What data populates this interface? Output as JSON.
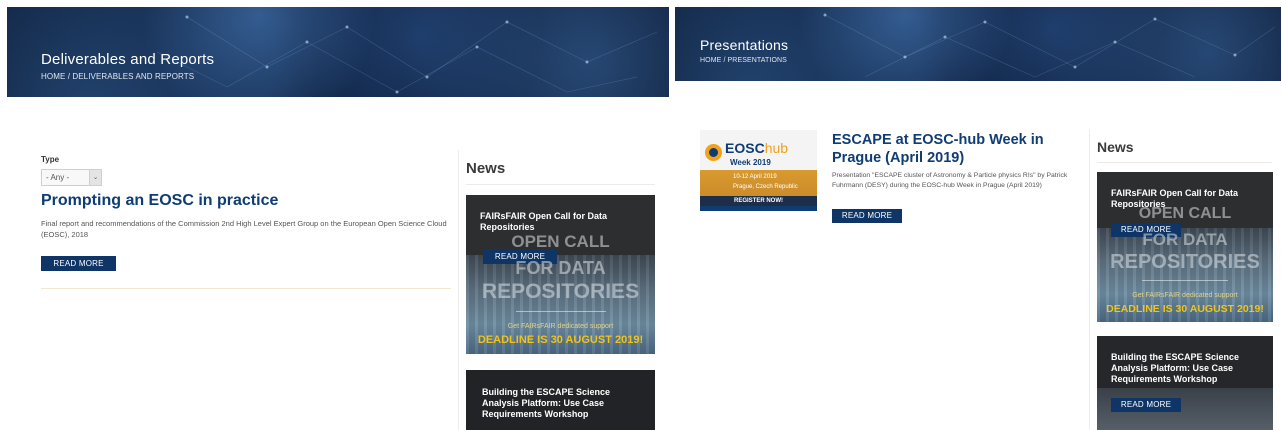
{
  "left": {
    "hero": {
      "title": "Deliverables and Reports",
      "breadcrumb": "HOME / DELIVERABLES AND REPORTS"
    },
    "filter": {
      "label": "Type",
      "selected": "- Any -"
    },
    "article": {
      "title": "Prompting an EOSC in practice",
      "summary": "Final report and recommendations of the Commission 2nd High Level Expert Group on the European Open Science Cloud (EOSC), 2018",
      "button": "READ MORE"
    },
    "news": {
      "heading": "News",
      "cards": [
        {
          "title": "FAIRsFAIR Open Call for Data Repositories",
          "button": "READ MORE",
          "poster_lines": [
            "OPEN CALL",
            "FOR DATA",
            "REPOSITORIES"
          ],
          "poster_sub": "Get FAIRsFAIR dedicated support",
          "poster_deadline": "DEADLINE IS 30 AUGUST 2019!"
        },
        {
          "title": "Building the ESCAPE Science Analysis Platform: Use Case Requirements Workshop"
        }
      ]
    }
  },
  "right": {
    "hero": {
      "title": "Presentations",
      "breadcrumb": "HOME / PRESENTATIONS"
    },
    "article": {
      "title": "ESCAPE at EOSC-hub Week in Prague (April 2019)",
      "summary": "Presentation \"ESCAPE cluster of Astronomy & Particle physics RIs\" by Patrick Fuhrmann (DESY) during the EOSC-hub Week in Prague (April 2019)",
      "button": "READ MORE",
      "thumb": {
        "brand": "EOSC",
        "brand_suffix": "hub",
        "subtitle": "Week 2019",
        "dates": "10-12 April 2019",
        "location": "Prague, Czech Republic",
        "cta": "REGISTER NOW!"
      }
    },
    "news": {
      "heading": "News",
      "cards": [
        {
          "title": "FAIRsFAIR Open Call for Data Repositories",
          "button": "READ MORE",
          "poster_lines": [
            "OPEN CALL",
            "FOR DATA",
            "REPOSITORIES"
          ],
          "poster_sub": "Get FAIRsFAIR dedicated support",
          "poster_deadline": "DEADLINE IS 30 AUGUST 2019!"
        },
        {
          "title": "Building the ESCAPE Science Analysis Platform: Use Case Requirements Workshop",
          "button": "READ MORE"
        }
      ]
    }
  },
  "colors": {
    "brand_blue": "#0e3566",
    "title_blue": "#0f3d73",
    "deadline_yellow": "#f0c419"
  }
}
